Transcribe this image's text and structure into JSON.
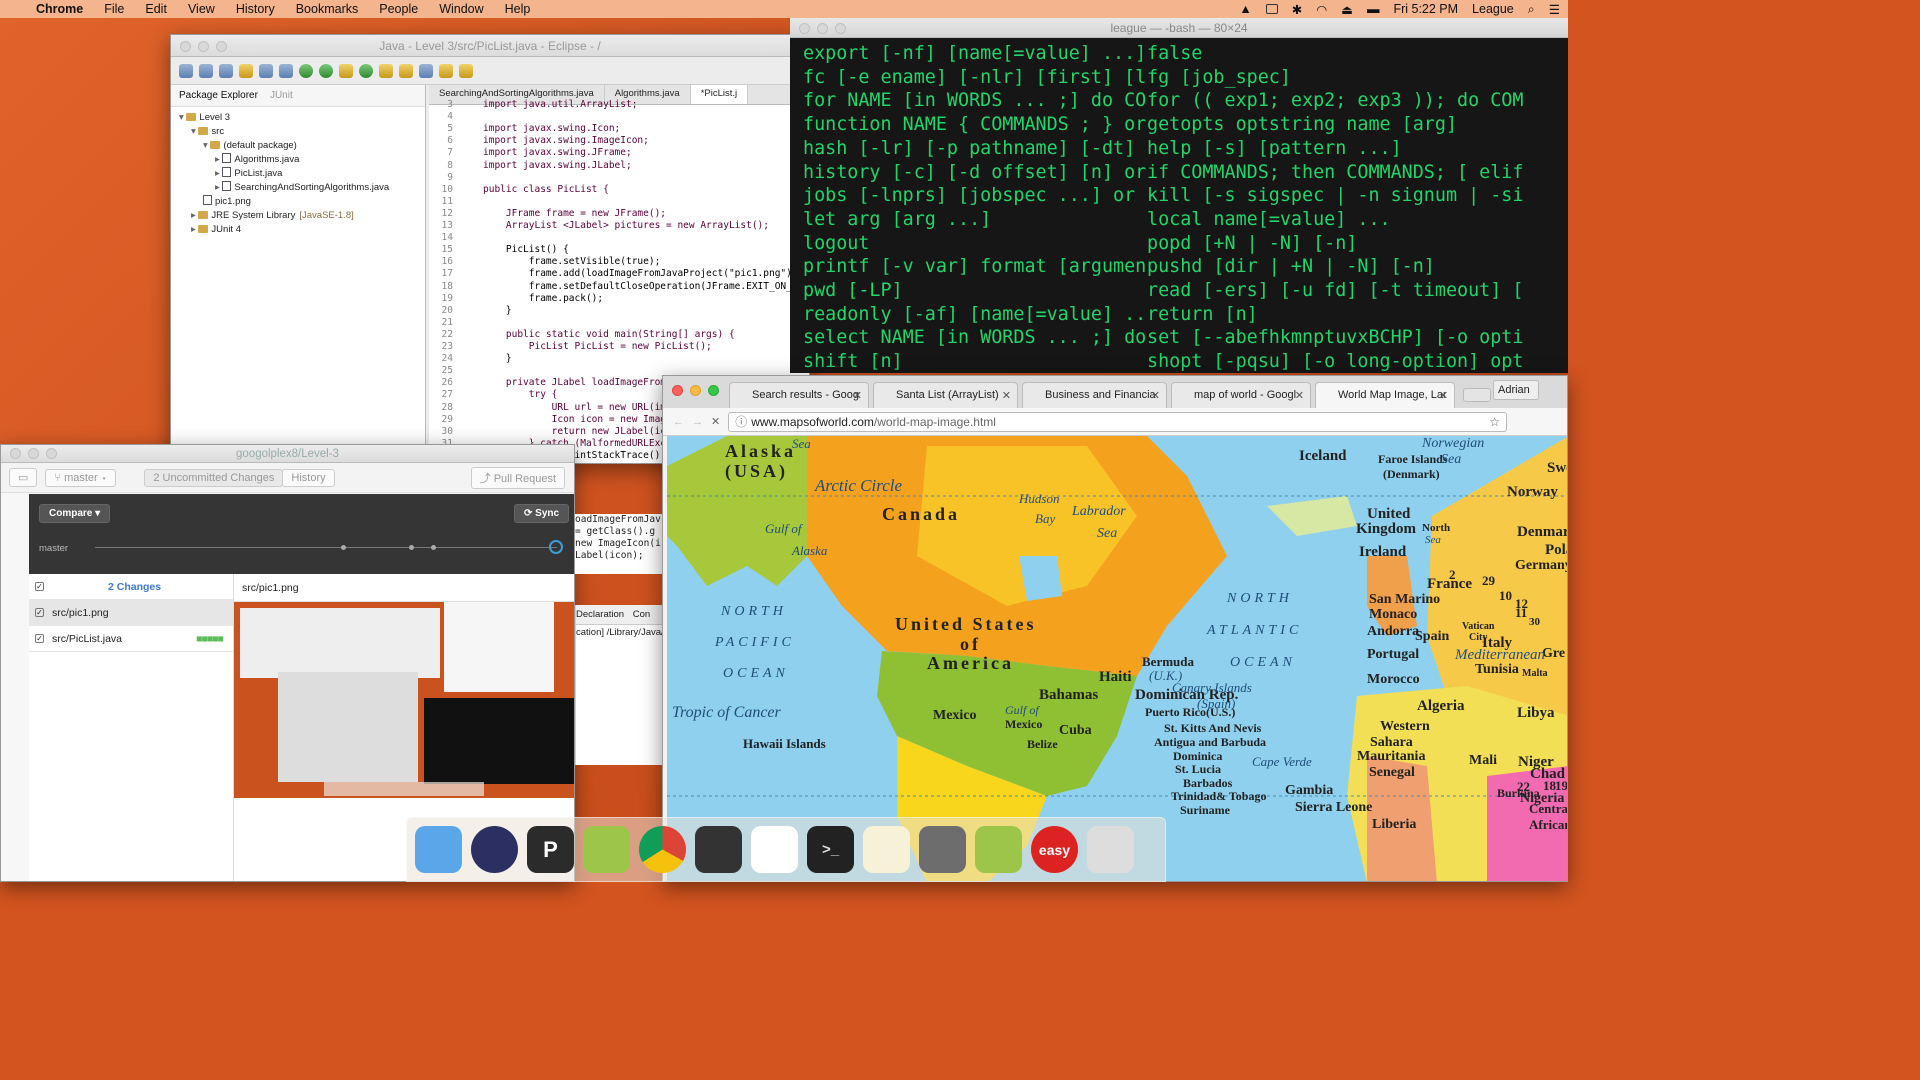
{
  "menubar": {
    "app": "Chrome",
    "items": [
      "File",
      "Edit",
      "View",
      "History",
      "Bookmarks",
      "People",
      "Window",
      "Help"
    ],
    "clock": "Fri 5:22 PM",
    "user": "League"
  },
  "eclipse": {
    "title": "Java - Level 3/src/PicList.java - Eclipse - /",
    "view_tab_active": "Package Explorer",
    "view_tab_other": "JUnit",
    "tree": [
      {
        "label": "Level 3",
        "indent": 0,
        "kind": "project"
      },
      {
        "label": "src",
        "indent": 1,
        "kind": "folder"
      },
      {
        "label": "(default package)",
        "indent": 2,
        "kind": "package"
      },
      {
        "label": "Algorithms.java",
        "indent": 3,
        "kind": "file"
      },
      {
        "label": "PicList.java",
        "indent": 3,
        "kind": "file"
      },
      {
        "label": "SearchingAndSortingAlgorithms.java",
        "indent": 3,
        "kind": "file"
      },
      {
        "label": "pic1.png",
        "indent": 2,
        "kind": "image"
      },
      {
        "label": "JRE System Library",
        "suffix": "[JavaSE-1.8]",
        "indent": 1,
        "kind": "lib"
      },
      {
        "label": "JUnit 4",
        "indent": 1,
        "kind": "lib"
      }
    ],
    "editor_tabs": [
      "SearchingAndSortingAlgorithms.java",
      "Algorithms.java",
      "*PicList.j"
    ],
    "code": [
      {
        "n": "3",
        "t": "import java.util.ArrayList;"
      },
      {
        "n": "4",
        "t": ""
      },
      {
        "n": "5",
        "t": "import javax.swing.Icon;"
      },
      {
        "n": "6",
        "t": "import javax.swing.ImageIcon;"
      },
      {
        "n": "7",
        "t": "import javax.swing.JFrame;"
      },
      {
        "n": "8",
        "t": "import javax.swing.JLabel;"
      },
      {
        "n": "9",
        "t": ""
      },
      {
        "n": "10",
        "t": "public class PicList {"
      },
      {
        "n": "11",
        "t": ""
      },
      {
        "n": "12",
        "t": "    JFrame frame = new JFrame();"
      },
      {
        "n": "13",
        "t": "    ArrayList <JLabel> pictures = new ArrayList();"
      },
      {
        "n": "14",
        "t": ""
      },
      {
        "n": "15",
        "t": "    PicList() {"
      },
      {
        "n": "16",
        "t": "        frame.setVisible(true);"
      },
      {
        "n": "17",
        "t": "        frame.add(loadImageFromJavaProject(\"pic1.png\"));"
      },
      {
        "n": "18",
        "t": "        frame.setDefaultCloseOperation(JFrame.EXIT_ON_CLOS"
      },
      {
        "n": "19",
        "t": "        frame.pack();"
      },
      {
        "n": "20",
        "t": "    }"
      },
      {
        "n": "21",
        "t": ""
      },
      {
        "n": "22",
        "t": "    public static void main(String[] args) {"
      },
      {
        "n": "23",
        "t": "        PicList PicList = new PicList();"
      },
      {
        "n": "24",
        "t": "    }"
      },
      {
        "n": "25",
        "t": ""
      },
      {
        "n": "26",
        "t": "    private JLabel loadImageFromThe"
      },
      {
        "n": "27",
        "t": "        try {"
      },
      {
        "n": "28",
        "t": "            URL url = new URL(image"
      },
      {
        "n": "29",
        "t": "            Icon icon = new ImageIc"
      },
      {
        "n": "30",
        "t": "            return new JLabel(icon);"
      },
      {
        "n": "31",
        "t": "        } catch (MalformedURLExcept"
      },
      {
        "n": "32",
        "t": "            e.printStackTrace();"
      }
    ],
    "code_tail": [
      "oadImageFromJav",
      "= getClass().g",
      "new ImageIcon(i",
      "Label(icon);"
    ],
    "bottom_tabs": [
      "Declaration",
      "Con"
    ],
    "bottom_text": "cation] /Library/Java/"
  },
  "terminal": {
    "title": "league — -bash — 80×24",
    "rows": [
      [
        "export [-nf] [name[=value] ...] or",
        "false"
      ],
      [
        "fc [-e ename] [-nlr] [first] [last",
        "fg [job_spec]"
      ],
      [
        "for NAME [in WORDS ... ;] do COMMA",
        "for (( exp1; exp2; exp3 )); do COM"
      ],
      [
        "function NAME { COMMANDS ; } or NA",
        "getopts optstring name [arg]"
      ],
      [
        "hash [-lr] [-p pathname] [-dt] [na",
        "help [-s] [pattern ...]"
      ],
      [
        "history [-c] [-d offset] [n] or hi",
        "if COMMANDS; then COMMANDS; [ elif"
      ],
      [
        "jobs [-lnprs] [jobspec ...] or job",
        "kill [-s sigspec | -n signum | -si"
      ],
      [
        "let arg [arg ...]",
        "local name[=value] ..."
      ],
      [
        "logout",
        "popd [+N | -N] [-n]"
      ],
      [
        "printf [-v var] format [arguments]",
        "pushd [dir | +N | -N] [-n]"
      ],
      [
        "pwd [-LP]",
        "read [-ers] [-u fd] [-t timeout] ["
      ],
      [
        "readonly [-af] [name[=value] ...]",
        "return [n]"
      ],
      [
        "select NAME [in WORDS ... ;] do CO",
        "set [--abefhkmnptuvxBCHP] [-o opti"
      ],
      [
        "shift [n]",
        "shopt [-pqsu] [-o long-option] opt"
      ]
    ]
  },
  "github": {
    "title": "googolplex8/Level-3",
    "branch": "master",
    "changes_tab": "2 Uncommitted Changes",
    "history_tab": "History",
    "pull_request": "Pull Request",
    "compare": "Compare",
    "sync": "Sync",
    "graph_label": "master",
    "changes_header": "2 Changes",
    "files": [
      "src/pic1.png",
      "src/PicList.java"
    ],
    "diff_path": "src/pic1.png"
  },
  "chrome": {
    "tabs": [
      {
        "title": "Search results - Goog"
      },
      {
        "title": "Santa List (ArrayList)"
      },
      {
        "title": "Business and Financia"
      },
      {
        "title": "map of world - Googl"
      },
      {
        "title": "World Map Image, Lar"
      }
    ],
    "profile": "Adrian",
    "url_domain": "www.mapsofworld.com",
    "url_path": "/world-map-image.html",
    "map_labels": [
      {
        "t": "Alaska",
        "big": true
      },
      {
        "t": "(USA)",
        "big": true
      },
      {
        "t": "Canada",
        "big": true
      },
      {
        "t": "Arctic Circle"
      },
      {
        "t": "Hudson"
      },
      {
        "t": "Bay"
      },
      {
        "t": "Gulf of"
      },
      {
        "t": "Alaska"
      },
      {
        "t": "Labrador"
      },
      {
        "t": "Sea"
      },
      {
        "t": "Iceland"
      },
      {
        "t": "Faroe Islands"
      },
      {
        "t": "(Denmark)"
      },
      {
        "t": "Sweden"
      },
      {
        "t": "Norway"
      },
      {
        "t": "Norwegian"
      },
      {
        "t": "Sea"
      },
      {
        "t": "United"
      },
      {
        "t": "Kingdom"
      },
      {
        "t": "Denmark"
      },
      {
        "t": "Ireland"
      },
      {
        "t": "North"
      },
      {
        "t": "Sea"
      },
      {
        "t": "Poland"
      },
      {
        "t": "Germany"
      },
      {
        "t": "France"
      },
      {
        "t": "San Marino"
      },
      {
        "t": "Monaco"
      },
      {
        "t": "Andorra"
      },
      {
        "t": "Spain"
      },
      {
        "t": "Portugal"
      },
      {
        "t": "Vatican"
      },
      {
        "t": "City"
      },
      {
        "t": "Italy"
      },
      {
        "t": "Gre"
      },
      {
        "t": "Mediterranean"
      },
      {
        "t": "Tunisia"
      },
      {
        "t": "Malta"
      },
      {
        "t": "Morocco"
      },
      {
        "t": "Algeria"
      },
      {
        "t": "Libya"
      },
      {
        "t": "Western"
      },
      {
        "t": "Sahara"
      },
      {
        "t": "Mauritania"
      },
      {
        "t": "Mali"
      },
      {
        "t": "Niger"
      },
      {
        "t": "Chad"
      },
      {
        "t": "Senegal"
      },
      {
        "t": "Gambia"
      },
      {
        "t": "Sierra Leone"
      },
      {
        "t": "Liberia"
      },
      {
        "t": "Nigeria"
      },
      {
        "t": "Centra"
      },
      {
        "t": "African"
      },
      {
        "t": "Burkina"
      },
      {
        "t": "NORTH"
      },
      {
        "t": "PACIFIC"
      },
      {
        "t": "OCEAN"
      },
      {
        "t": "NORTH"
      },
      {
        "t": "ATLANTIC"
      },
      {
        "t": "OCEAN"
      },
      {
        "t": "United States",
        "big": true
      },
      {
        "t": "of",
        "big": true
      },
      {
        "t": "America",
        "big": true
      },
      {
        "t": "Bermuda"
      },
      {
        "t": "(U.K.)"
      },
      {
        "t": "Haiti"
      },
      {
        "t": "Bahamas"
      },
      {
        "t": "Dominican Rep."
      },
      {
        "t": "Puerto Rico(U.S.)"
      },
      {
        "t": "St. Kitts And Nevis"
      },
      {
        "t": "Antigua and Barbuda"
      },
      {
        "t": "Dominica"
      },
      {
        "t": "St. Lucia"
      },
      {
        "t": "Barbados"
      },
      {
        "t": "Trinidad& Tobago"
      },
      {
        "t": "Suriname"
      },
      {
        "t": "Canary Islands"
      },
      {
        "t": "(Spain)"
      },
      {
        "t": "Cape Verde"
      },
      {
        "t": "Mexico"
      },
      {
        "t": "Gulf of"
      },
      {
        "t": "Mexico"
      },
      {
        "t": "Cuba"
      },
      {
        "t": "Belize"
      },
      {
        "t": "Tropic of Cancer"
      },
      {
        "t": "Hawaii Islands"
      },
      {
        "t": "Sea"
      },
      {
        "t": "2"
      },
      {
        "t": "29"
      },
      {
        "t": "10"
      },
      {
        "t": "11"
      },
      {
        "t": "12"
      },
      {
        "t": "30"
      },
      {
        "t": "18"
      },
      {
        "t": "19"
      },
      {
        "t": "22"
      }
    ]
  },
  "dock": [
    "Finder",
    "Eclipse",
    "P",
    "Android Studio",
    "Chrome",
    "GitHub",
    "Drive",
    "Terminal",
    "TextEdit",
    "System Preferences",
    "Android Studio",
    "easy",
    "Trash"
  ],
  "colors": {
    "terminal_text": "#22d46a",
    "desktop": "#d3541f",
    "menubar": "#f3b48e"
  }
}
